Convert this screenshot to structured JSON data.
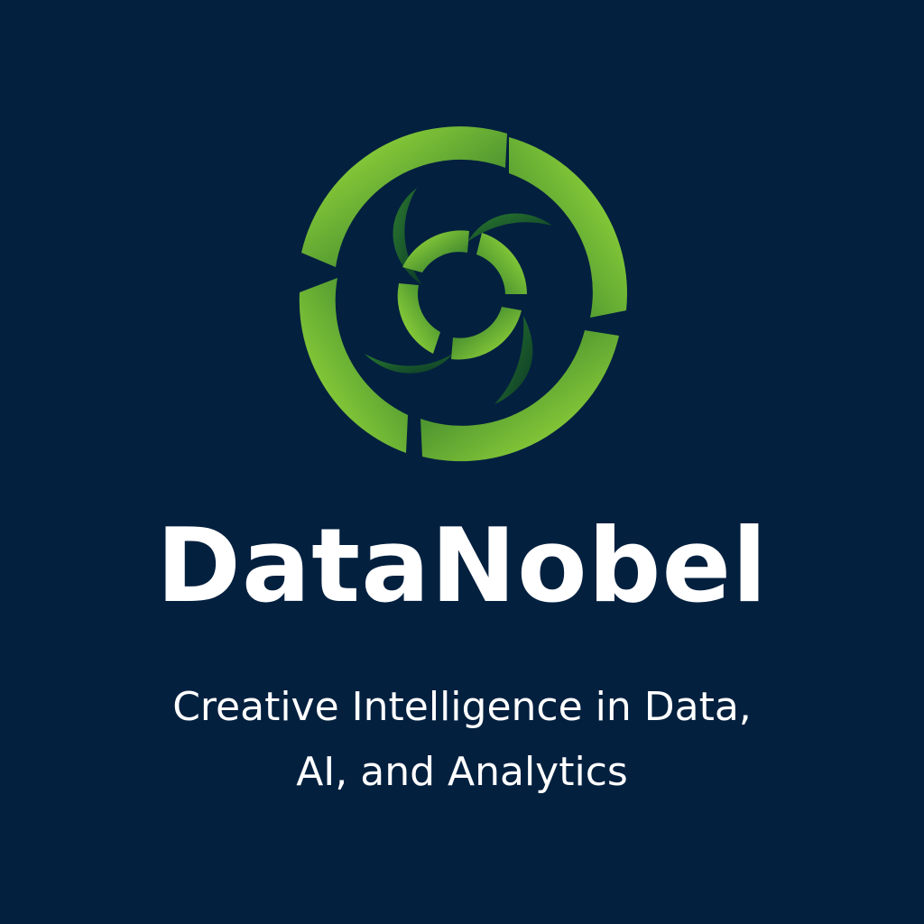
{
  "brand": {
    "name": "DataNobel",
    "tagline_line1": "Creative Intelligence in Data,",
    "tagline_line2": "AI, and Analytics"
  },
  "logo": {
    "icon": "green-swirl-ring-logo-icon"
  },
  "colors": {
    "background": "#03203f",
    "accent_light": "#9fe03a",
    "accent_dark": "#1f6a2a",
    "text": "#ffffff"
  }
}
